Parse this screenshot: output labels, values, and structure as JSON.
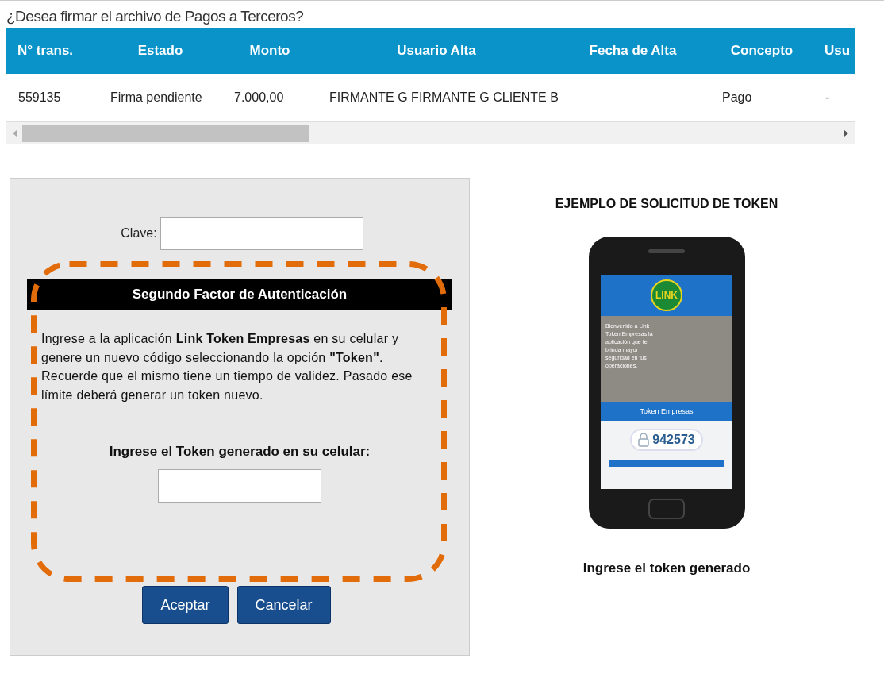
{
  "dialog": {
    "title": "¿Desea firmar el archivo de Pagos a Terceros?"
  },
  "table": {
    "columns": [
      "N° trans.",
      "Estado",
      "Monto",
      "Usuario Alta",
      "Fecha de Alta",
      "Concepto",
      "Usu"
    ],
    "rows": [
      {
        "cells": [
          "559135",
          "Firma pendiente",
          "7.000,00",
          "FIRMANTE G FIRMANTE G CLIENTE B",
          null,
          "Pago",
          "-"
        ]
      }
    ]
  },
  "form": {
    "password_label": "Clave:",
    "section_title": "Segundo Factor de Autenticación",
    "instructions": "Ingrese a la aplicación **Link Token Empresas** en su celular y genere un nuevo código seleccionando la opción **\"Token\"**. Recuerde que el mismo tiene un tiempo de validez. Pasado ese límite deberá generar un token nuevo.",
    "token_label": "Ingrese el Token generado en su celular:",
    "buttons": [
      "Aceptar",
      "Cancelar"
    ]
  },
  "example": {
    "title": "EJEMPLO DE SOLICITUD DE TOKEN",
    "phone": {
      "logo": "LINK",
      "welcome": "Bienvenido a Link Token Empresas la aplicación que te brinda mayor seguridad en tus operaciones.",
      "app_name": "Token Empresas",
      "code": "942573"
    },
    "caption": "Ingrese el token generado"
  }
}
